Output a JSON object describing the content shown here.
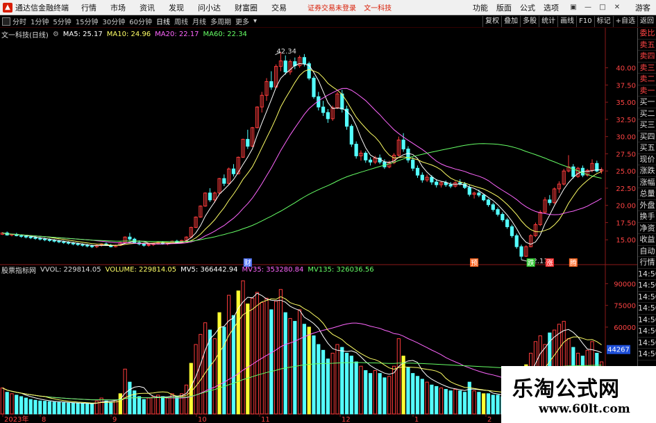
{
  "menubar": {
    "app_title": "通达信金融终端",
    "items": [
      "行情",
      "市场",
      "资讯",
      "发现",
      "问小达",
      "财富圈",
      "交易"
    ],
    "notice": [
      "证券交易未登录",
      "文一科技"
    ],
    "right_items": [
      "功能",
      "版面",
      "公式",
      "选项"
    ],
    "guest": "游客"
  },
  "periodbar": {
    "periods": [
      "分时",
      "1分钟",
      "5分钟",
      "15分钟",
      "30分钟",
      "60分钟",
      "日线",
      "周线",
      "月线",
      "多周期",
      "更多"
    ],
    "active": "日线",
    "tools": [
      "复权",
      "叠加",
      "多股",
      "统计",
      "画线",
      "F10",
      "标记",
      "+自选",
      "返回"
    ]
  },
  "price_legend": {
    "title": "文一科技(日线)",
    "ma5": "MA5: 25.17",
    "ma10": "MA10: 24.96",
    "ma20": "MA20: 22.17",
    "ma60": "MA60: 22.34"
  },
  "vol_legend": {
    "title": "股票指标网",
    "vvol": "VVOL: 229814.05",
    "volume": "VOLUME: 229814.05",
    "mv5": "MV5: 366442.94",
    "mv35": "MV35: 353280.84",
    "mv135": "MV135: 326036.56"
  },
  "colors": {
    "up": "#ff3c3c",
    "down": "#54ffff",
    "ma5": "#ffffff",
    "ma10": "#ffff66",
    "ma20": "#ff66ff",
    "ma60": "#66ff66",
    "highlight": "#ffff33"
  },
  "right_panel": {
    "items": [
      "委比",
      "卖五",
      "卖四",
      "卖三",
      "卖二",
      "卖一",
      "买一",
      "买二",
      "买三",
      "买四",
      "买五",
      "现价",
      "涨跌",
      "涨幅",
      "总量",
      "外盘",
      "换手",
      "净资",
      "收益",
      "自动",
      "行情",
      "14:50",
      "14:50",
      "14:50",
      "14:50",
      "14:50",
      "14:50",
      "14:50",
      "14:50"
    ]
  },
  "chart_data": {
    "type": "candlestick",
    "price_axis": {
      "labels": [
        "40.00",
        "37.50",
        "35.00",
        "32.50",
        "30.00",
        "27.50",
        "25.00",
        "22.50",
        "20.00",
        "17.50",
        "15.00"
      ],
      "ylim": [
        12.5,
        44
      ]
    },
    "volume_axis": {
      "labels": [
        "90000",
        "75000",
        "60000"
      ],
      "current": "44267"
    },
    "annotations": {
      "high": "42.34",
      "low": "12.11",
      "markers": [
        "财",
        "预",
        "跌",
        "涨",
        "腾"
      ]
    },
    "x_labels": [
      "2023年",
      "8",
      "9",
      "10",
      "11",
      "12",
      "1",
      "2"
    ],
    "candles": [
      [
        15.8,
        16.1,
        15.7,
        16.0
      ],
      [
        16.0,
        16.2,
        15.6,
        15.7
      ],
      [
        15.7,
        15.9,
        15.5,
        15.8
      ],
      [
        15.8,
        16.0,
        15.5,
        15.6
      ],
      [
        15.6,
        15.8,
        15.3,
        15.5
      ],
      [
        15.5,
        15.7,
        15.2,
        15.4
      ],
      [
        15.4,
        15.6,
        15.1,
        15.3
      ],
      [
        15.3,
        15.5,
        15.0,
        15.2
      ],
      [
        15.2,
        15.4,
        14.9,
        15.1
      ],
      [
        15.1,
        15.3,
        14.8,
        15.0
      ],
      [
        15.0,
        15.2,
        14.7,
        14.9
      ],
      [
        14.9,
        15.1,
        14.6,
        14.8
      ],
      [
        14.8,
        15.0,
        14.5,
        14.7
      ],
      [
        14.7,
        14.9,
        14.4,
        14.6
      ],
      [
        14.6,
        14.8,
        14.3,
        14.5
      ],
      [
        14.5,
        14.7,
        14.2,
        14.4
      ],
      [
        14.4,
        14.6,
        14.1,
        14.3
      ],
      [
        14.3,
        14.5,
        14.0,
        14.2
      ],
      [
        14.2,
        14.4,
        13.9,
        14.1
      ],
      [
        14.1,
        14.3,
        13.8,
        14.0
      ],
      [
        14.0,
        14.3,
        13.8,
        14.2
      ],
      [
        14.2,
        14.5,
        14.0,
        14.4
      ],
      [
        14.4,
        14.6,
        14.1,
        14.2
      ],
      [
        14.2,
        14.4,
        13.9,
        14.0
      ],
      [
        14.0,
        14.3,
        13.9,
        14.2
      ],
      [
        14.2,
        14.7,
        14.1,
        14.6
      ],
      [
        14.6,
        15.5,
        14.5,
        15.4
      ],
      [
        15.4,
        16.0,
        14.9,
        15.1
      ],
      [
        15.1,
        15.3,
        14.5,
        14.6
      ],
      [
        14.6,
        14.9,
        14.2,
        14.4
      ],
      [
        14.4,
        14.6,
        14.0,
        14.2
      ],
      [
        14.2,
        14.5,
        14.0,
        14.3
      ],
      [
        14.3,
        14.6,
        14.1,
        14.5
      ],
      [
        14.5,
        14.8,
        14.3,
        14.6
      ],
      [
        14.6,
        14.8,
        14.3,
        14.4
      ],
      [
        14.4,
        14.6,
        14.2,
        14.5
      ],
      [
        14.5,
        14.9,
        14.4,
        14.8
      ],
      [
        14.8,
        15.0,
        14.5,
        14.6
      ],
      [
        14.6,
        15.0,
        14.5,
        14.9
      ],
      [
        14.9,
        15.5,
        14.8,
        15.4
      ],
      [
        15.4,
        16.9,
        15.3,
        16.8
      ],
      [
        16.8,
        18.4,
        16.7,
        18.3
      ],
      [
        18.3,
        20.0,
        18.2,
        19.9
      ],
      [
        19.9,
        21.9,
        19.8,
        21.8
      ],
      [
        21.8,
        22.5,
        20.5,
        20.8
      ],
      [
        20.8,
        22.0,
        20.4,
        21.8
      ],
      [
        21.8,
        24.0,
        21.6,
        23.9
      ],
      [
        23.9,
        24.5,
        22.8,
        23.2
      ],
      [
        23.2,
        25.5,
        23.0,
        25.3
      ],
      [
        25.3,
        26.0,
        24.2,
        24.6
      ],
      [
        24.6,
        27.1,
        24.5,
        27.0
      ],
      [
        27.0,
        29.7,
        26.9,
        29.6
      ],
      [
        29.6,
        31.0,
        28.2,
        28.6
      ],
      [
        28.6,
        31.4,
        28.5,
        31.3
      ],
      [
        31.3,
        34.4,
        31.2,
        34.3
      ],
      [
        34.3,
        36.5,
        33.5,
        36.0
      ],
      [
        36.0,
        38.5,
        35.2,
        38.0
      ],
      [
        38.0,
        39.5,
        36.8,
        37.2
      ],
      [
        37.2,
        40.5,
        37.0,
        40.2
      ],
      [
        40.2,
        42.3,
        39.5,
        41.0
      ],
      [
        41.0,
        41.8,
        39.0,
        39.4
      ],
      [
        39.4,
        41.2,
        39.0,
        40.9
      ],
      [
        40.9,
        41.5,
        39.8,
        40.3
      ],
      [
        40.3,
        41.8,
        40.0,
        41.5
      ],
      [
        41.5,
        42.0,
        40.2,
        40.6
      ],
      [
        40.6,
        40.9,
        38.2,
        38.5
      ],
      [
        38.5,
        38.8,
        35.5,
        35.8
      ],
      [
        35.8,
        36.5,
        33.8,
        34.3
      ],
      [
        34.3,
        35.2,
        33.0,
        33.5
      ],
      [
        33.5,
        34.0,
        32.0,
        32.6
      ],
      [
        32.6,
        34.5,
        32.3,
        34.2
      ],
      [
        34.2,
        36.5,
        34.0,
        36.2
      ],
      [
        36.2,
        36.8,
        33.5,
        34.0
      ],
      [
        34.0,
        34.5,
        31.0,
        31.5
      ],
      [
        31.5,
        31.8,
        28.5,
        28.9
      ],
      [
        28.9,
        29.3,
        26.8,
        27.2
      ],
      [
        27.2,
        28.0,
        26.5,
        27.6
      ],
      [
        27.6,
        27.9,
        26.2,
        26.6
      ],
      [
        26.6,
        27.0,
        25.8,
        26.3
      ],
      [
        26.3,
        27.2,
        26.0,
        26.9
      ],
      [
        26.9,
        27.4,
        26.0,
        26.3
      ],
      [
        26.3,
        26.7,
        25.3,
        25.6
      ],
      [
        25.6,
        26.5,
        25.4,
        26.2
      ],
      [
        26.2,
        27.6,
        26.0,
        27.3
      ],
      [
        27.3,
        30.0,
        27.1,
        29.5
      ],
      [
        29.5,
        30.5,
        27.8,
        28.2
      ],
      [
        28.2,
        28.6,
        26.2,
        26.6
      ],
      [
        26.6,
        27.0,
        25.0,
        25.4
      ],
      [
        25.4,
        25.8,
        24.0,
        24.4
      ],
      [
        24.4,
        24.8,
        23.3,
        23.7
      ],
      [
        23.7,
        24.5,
        23.4,
        24.1
      ],
      [
        24.1,
        24.4,
        23.0,
        23.4
      ],
      [
        23.4,
        23.8,
        22.6,
        23.0
      ],
      [
        23.0,
        23.5,
        22.6,
        23.3
      ],
      [
        23.3,
        23.6,
        22.7,
        23.0
      ],
      [
        23.0,
        23.4,
        22.5,
        22.8
      ],
      [
        22.8,
        23.5,
        22.6,
        23.3
      ],
      [
        23.3,
        23.8,
        22.9,
        23.1
      ],
      [
        23.1,
        23.4,
        22.4,
        22.6
      ],
      [
        22.6,
        23.0,
        21.3,
        21.6
      ],
      [
        21.6,
        22.0,
        21.0,
        21.8
      ],
      [
        21.8,
        22.3,
        21.2,
        21.5
      ],
      [
        21.5,
        21.7,
        20.6,
        20.8
      ],
      [
        20.8,
        21.0,
        19.8,
        20.1
      ],
      [
        20.1,
        20.4,
        19.1,
        19.4
      ],
      [
        19.4,
        19.7,
        18.4,
        18.7
      ],
      [
        18.7,
        19.0,
        17.6,
        17.9
      ],
      [
        17.9,
        18.2,
        16.6,
        16.9
      ],
      [
        16.9,
        17.2,
        15.3,
        15.6
      ],
      [
        15.6,
        15.9,
        13.7,
        14.0
      ],
      [
        14.0,
        14.3,
        12.1,
        12.6
      ],
      [
        12.6,
        14.2,
        12.5,
        14.0
      ],
      [
        14.0,
        15.8,
        13.9,
        15.6
      ],
      [
        15.6,
        17.5,
        15.4,
        17.2
      ],
      [
        17.2,
        19.3,
        17.0,
        19.0
      ],
      [
        19.0,
        21.2,
        18.8,
        20.8
      ],
      [
        20.8,
        21.5,
        20.0,
        20.4
      ],
      [
        20.4,
        22.6,
        20.2,
        22.4
      ],
      [
        22.4,
        23.5,
        21.8,
        23.1
      ],
      [
        23.1,
        25.3,
        22.9,
        25.0
      ],
      [
        25.0,
        27.3,
        24.8,
        25.6
      ],
      [
        25.6,
        26.0,
        23.9,
        24.2
      ],
      [
        24.2,
        25.6,
        24.0,
        25.4
      ],
      [
        25.4,
        25.8,
        24.1,
        24.4
      ],
      [
        24.4,
        25.3,
        24.2,
        25.1
      ],
      [
        25.1,
        26.7,
        24.8,
        26.1
      ],
      [
        26.1,
        26.5,
        24.8,
        25.0
      ],
      [
        25.0,
        25.5,
        24.6,
        25.2
      ]
    ],
    "volumes": [
      18000,
      15000,
      14000,
      13000,
      12000,
      11000,
      10000,
      9500,
      9000,
      8800,
      8500,
      8200,
      8000,
      7800,
      7600,
      7500,
      7300,
      7200,
      7000,
      6800,
      9000,
      11000,
      9000,
      8000,
      9500,
      14000,
      31000,
      22000,
      16000,
      12000,
      10000,
      11000,
      12000,
      13000,
      12000,
      11000,
      14000,
      12000,
      14000,
      20000,
      35000,
      48000,
      55000,
      63000,
      58000,
      52000,
      70000,
      60000,
      82000,
      68000,
      85000,
      92000,
      76000,
      80000,
      84000,
      77000,
      80000,
      72000,
      78000,
      86000,
      70000,
      66000,
      64000,
      72000,
      62000,
      60000,
      54000,
      48000,
      44000,
      38000,
      42000,
      48000,
      46000,
      42000,
      40000,
      36000,
      33000,
      30000,
      28000,
      30000,
      28000,
      25000,
      26000,
      33000,
      52000,
      40000,
      32000,
      28000,
      26000,
      24000,
      22000,
      20000,
      19000,
      18000,
      17000,
      16000,
      17000,
      16000,
      15000,
      22000,
      16000,
      15000,
      14000,
      14000,
      13000,
      13000,
      12000,
      14000,
      16000,
      20000,
      28000,
      34000,
      42000,
      50000,
      54000,
      48000,
      56000,
      58000,
      62000,
      64000,
      52000,
      46000,
      42000,
      40000,
      44000,
      50000,
      42000,
      36000
    ],
    "highlight_volume_indices": [
      25,
      40,
      46,
      50,
      52,
      65,
      85,
      102,
      111
    ]
  }
}
